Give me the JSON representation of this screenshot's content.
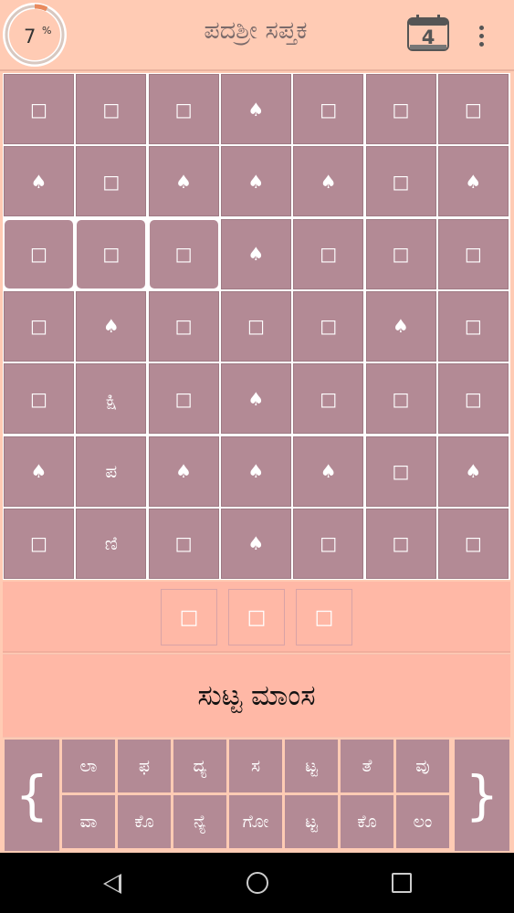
{
  "header": {
    "progress_value": "7",
    "progress_unit": "%",
    "title": "ಪದಶ್ರೀ ಸಪ್ತಕ",
    "calendar_day": "4",
    "progress_fraction": 0.07
  },
  "grid": {
    "rows": [
      [
        "□",
        "□",
        "□",
        "♠",
        "□",
        "□",
        "□"
      ],
      [
        "♠",
        "□",
        "♠",
        "♠",
        "♠",
        "□",
        "♠"
      ],
      [
        "□",
        "□",
        "□",
        "♠",
        "□",
        "□",
        "□"
      ],
      [
        "□",
        "♠",
        "□",
        "□",
        "□",
        "♠",
        "□"
      ],
      [
        "□",
        "ಕ್ಷಿ",
        "□",
        "♠",
        "□",
        "□",
        "□"
      ],
      [
        "♠",
        "ಪ",
        "♠",
        "♠",
        "♠",
        "□",
        "♠"
      ],
      [
        "□",
        "ಣಿ",
        "□",
        "♠",
        "□",
        "□",
        "□"
      ]
    ],
    "selected": [
      [
        2,
        0
      ],
      [
        2,
        1
      ],
      [
        2,
        2
      ]
    ]
  },
  "answer_slots": [
    "□",
    "□",
    "□"
  ],
  "clue": "ಸುಟ್ಟ ಮಾಂಸ",
  "keyboard": {
    "left_brace": "{",
    "right_brace": "}",
    "rows": [
      [
        "ಲಾ",
        "ಫ",
        "ದ್ಯ",
        "ಸ",
        "ಟ್ಟ",
        "ತೆ",
        "ವು"
      ],
      [
        "ವಾ",
        "ಕೊ",
        "ನ್ಯೆ",
        "ಗೋ",
        "ಟ್ಟ",
        "ಕೊ",
        "ಲಂ"
      ]
    ]
  },
  "colors": {
    "background": "#FFCBB4",
    "cell": "#b38a95",
    "strip": "#FFB8A6"
  }
}
